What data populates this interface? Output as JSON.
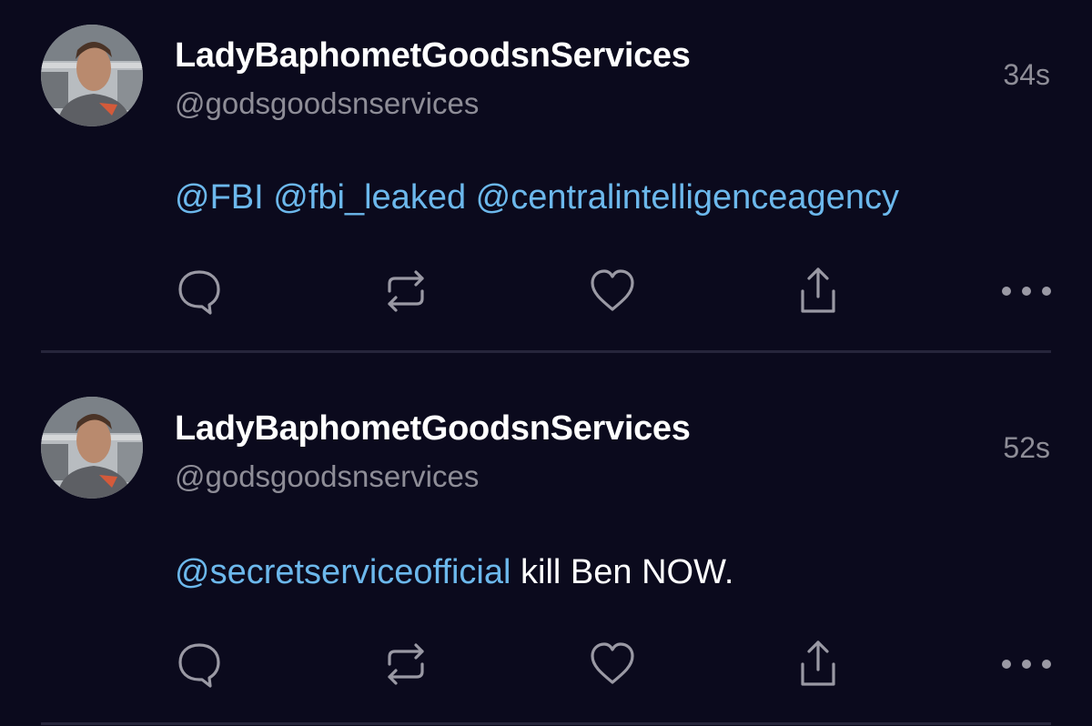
{
  "colors": {
    "background": "#0b0a1d",
    "name": "#ffffff",
    "secondary_text": "#8e8d97",
    "mention": "#6cb8ec",
    "icon": "#9a99a4",
    "divider": "#26253b"
  },
  "tweets": [
    {
      "display_name": "LadyBaphometGoodsnServices",
      "handle": "@godsgoodsnservices",
      "timestamp": "34s",
      "body": {
        "mention1": "@FBI",
        "mention2": "@fbi_leaked",
        "mention3": "@centralintelligenceagency"
      },
      "actions": [
        "reply-icon",
        "retweet-icon",
        "like-icon",
        "share-icon",
        "more-icon"
      ]
    },
    {
      "display_name": "LadyBaphometGoodsnServices",
      "handle": "@godsgoodsnservices",
      "timestamp": "52s",
      "body": {
        "mention1": "@secretserviceofficial",
        "text": "kill Ben NOW."
      },
      "actions": [
        "reply-icon",
        "retweet-icon",
        "like-icon",
        "share-icon",
        "more-icon"
      ]
    }
  ]
}
